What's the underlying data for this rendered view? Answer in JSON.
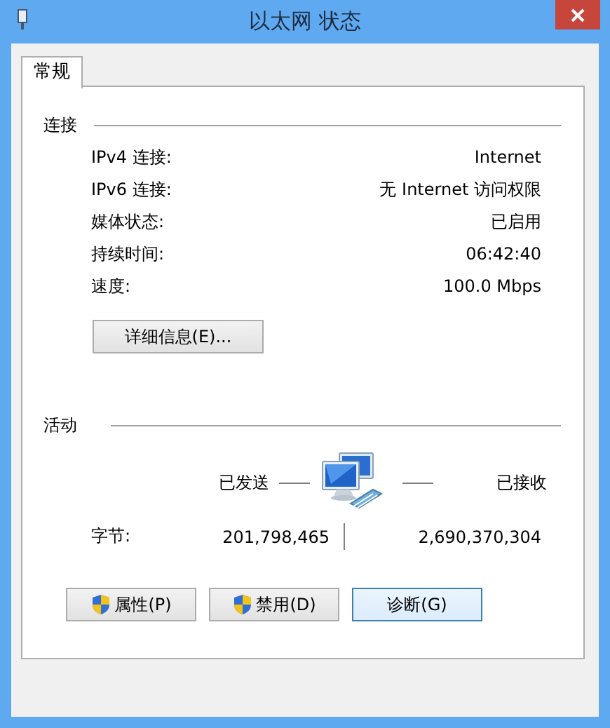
{
  "window": {
    "title": "以太网 状态"
  },
  "tabs": [
    {
      "label": "常规",
      "selected": true
    }
  ],
  "connection": {
    "heading": "连接",
    "rows": [
      {
        "label": "IPv4 连接:",
        "value": "Internet"
      },
      {
        "label": "IPv6 连接:",
        "value": "无 Internet 访问权限"
      },
      {
        "label": "媒体状态:",
        "value": "已启用"
      },
      {
        "label": "持续时间:",
        "value": "06:42:40"
      },
      {
        "label": "速度:",
        "value": "100.0 Mbps"
      }
    ],
    "details_button": "详细信息(E)..."
  },
  "activity": {
    "heading": "活动",
    "sent_label": "已发送",
    "received_label": "已接收",
    "bytes_label": "字节:",
    "sent": "201,798,465",
    "received": "2,690,370,304"
  },
  "buttons": [
    {
      "label": "属性(P)",
      "shield": true,
      "focused": false
    },
    {
      "label": "禁用(D)",
      "shield": true,
      "focused": false
    },
    {
      "label": "诊断(G)",
      "shield": false,
      "focused": true
    }
  ]
}
